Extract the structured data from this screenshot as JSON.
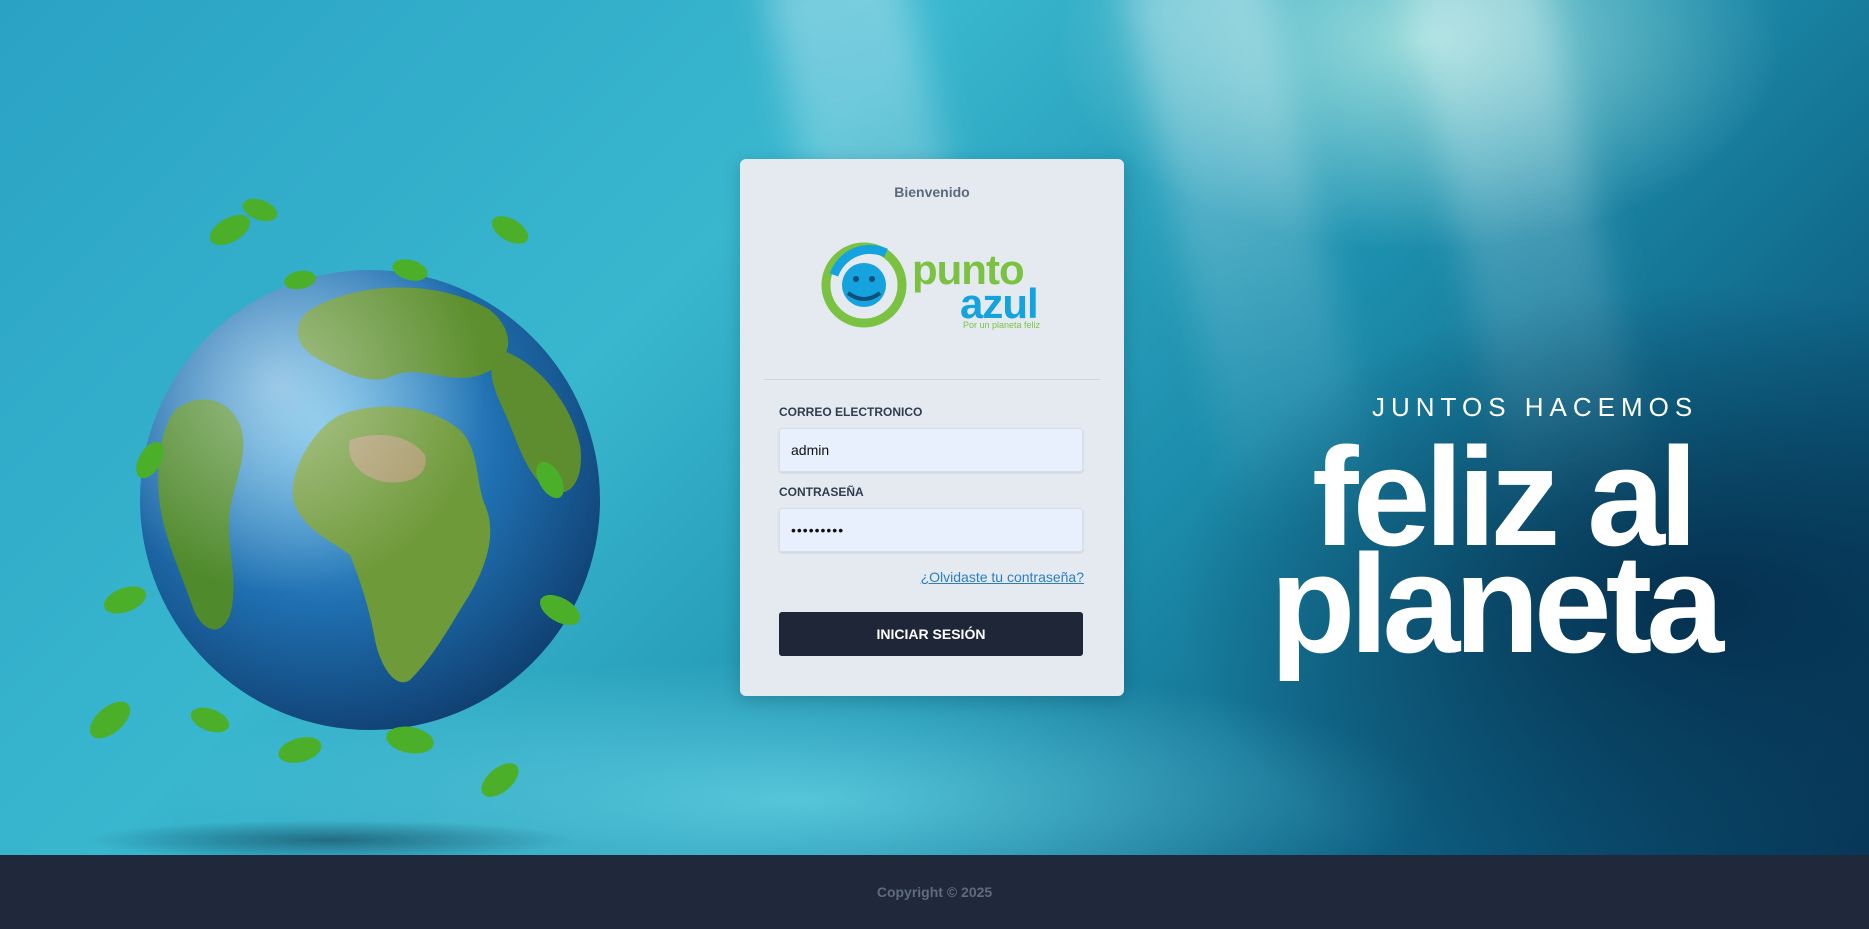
{
  "login": {
    "title": "Bienvenido",
    "logo": {
      "word_top": "punto",
      "word_bottom": "azul",
      "tagline": "Por un planeta feliz"
    },
    "email": {
      "label": "CORREO ELECTRONICO",
      "value": "admin"
    },
    "password": {
      "label": "CONTRASEÑA",
      "value": "•••••••••"
    },
    "forgot_link": "¿Olvidaste tu contraseña?",
    "submit_label": "INICIAR SESIÓN"
  },
  "hero": {
    "slogan_small": "JUNTOS HACEMOS",
    "slogan_line_1": "feliz al",
    "slogan_line_2": "planeta"
  },
  "footer": {
    "copyright": "Copyright © 2025"
  },
  "colors": {
    "logo_green": "#7cc242",
    "logo_blue": "#14a3de",
    "button_dark": "#1e2638",
    "footer_bg": "#1f293b",
    "card_bg": "#e5eaf1"
  }
}
